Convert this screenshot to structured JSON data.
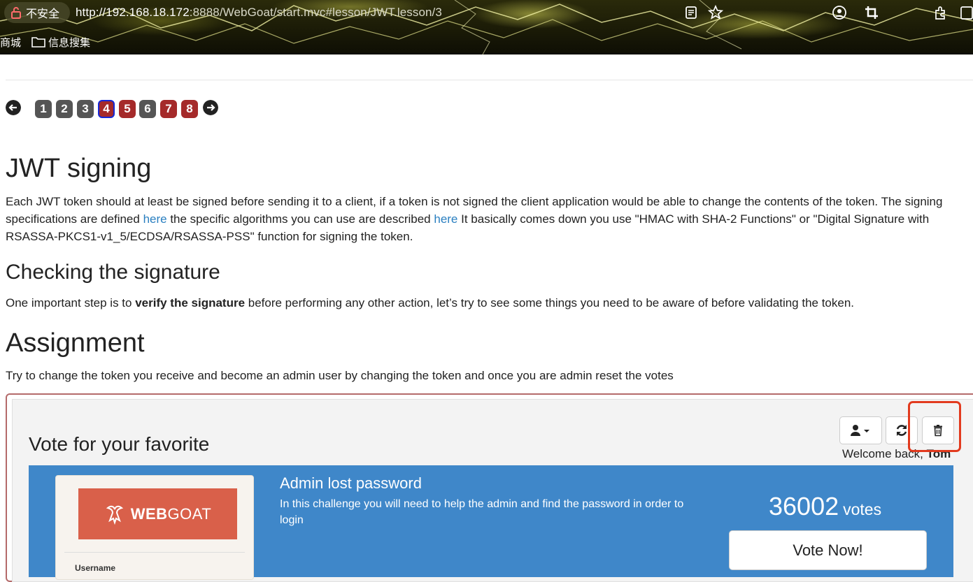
{
  "browser": {
    "security_label": "不安全",
    "url_host": "http://192.168.18.172",
    "url_rest": ":8888/WebGoat/start.mvc#lesson/JWT.lesson/3",
    "bookmarks": [
      "商城",
      "信息搜集"
    ]
  },
  "pager": {
    "pages": [
      "1",
      "2",
      "3",
      "4",
      "5",
      "6",
      "7",
      "8"
    ],
    "current": "4"
  },
  "lesson": {
    "title": "JWT signing",
    "intro_1": "Each JWT token should at least be signed before sending it to a client, if a token is not signed the client application would be able to change the contents of the token. The signing specifications are defined ",
    "link_1": "here",
    "intro_2": " the specific algorithms you can use are described ",
    "link_2": "here",
    "intro_3": " It basically comes down you use \"HMAC with SHA-2 Functions\" or \"Digital Signature with RSASSA-PKCS1-v1_5/ECDSA/RSASSA-PSS\" function for signing the token.",
    "check_heading": "Checking the signature",
    "check_1": "One important step is to ",
    "check_bold": "verify the signature",
    "check_2": " before performing any other action, let’s try to see some things you need to be aware of before validating the token.",
    "assign_heading": "Assignment",
    "assign_text": "Try to change the token you receive and become an admin user by changing the token and once you are admin reset the votes"
  },
  "widget": {
    "heading": "Vote for your favorite",
    "welcome_prefix": "Welcome back, ",
    "welcome_user": "Tom",
    "icons": [
      "user-icon",
      "caret-down-icon",
      "refresh-icon",
      "trash-icon"
    ],
    "card": {
      "title": "Admin lost password",
      "description": "In this challenge you will need to help the admin and find the password in order to login",
      "votes": "36002",
      "votes_label": "votes",
      "vote_button": "Vote Now!",
      "logo_bold": "WEB",
      "logo_light": "GOAT",
      "thumb_field": "Username"
    }
  },
  "colors": {
    "accent_blue": "#3f87c9",
    "pager_red": "#a52a2a",
    "highlight_red": "#e23a1e",
    "logo_red": "#d9604a"
  }
}
